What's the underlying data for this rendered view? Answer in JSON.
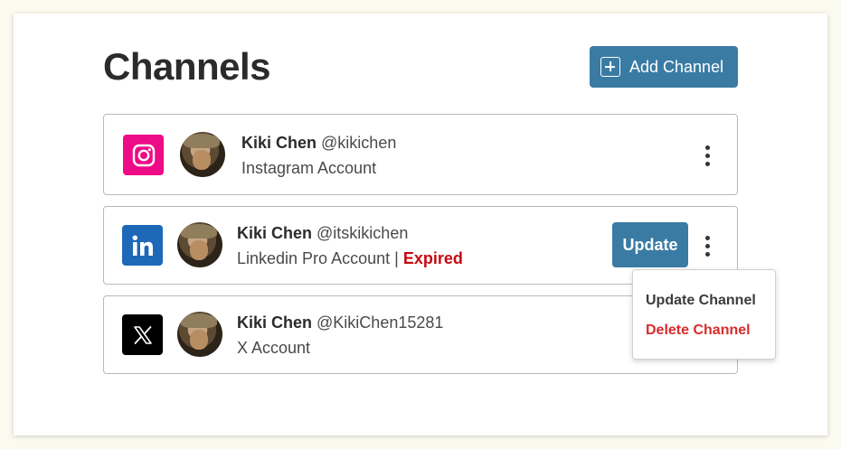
{
  "page": {
    "title": "Channels",
    "add_button_label": "Add Channel"
  },
  "channels": [
    {
      "platform": "instagram",
      "platform_icon": "instagram-icon",
      "platform_color": "#ee0b87",
      "name": "Kiki Chen",
      "handle": "@kikichen",
      "account_type": "Instagram Account"
    },
    {
      "platform": "linkedin",
      "platform_icon": "linkedin-icon",
      "platform_color": "#1e68b8",
      "name": "Kiki Chen",
      "handle": "@itskikichen",
      "account_type": "Linkedin Pro Account",
      "separator": " | ",
      "status": "Expired",
      "status_color": "#c40b10",
      "update_label": "Update"
    },
    {
      "platform": "x",
      "platform_icon": "x-icon",
      "platform_color": "#000000",
      "name": "Kiki Chen",
      "handle": "@KikiChen15281",
      "account_type": "X Account"
    }
  ],
  "context_menu": {
    "items": [
      {
        "label": "Update Channel",
        "color": "#3b3b3b"
      },
      {
        "label": "Delete Channel",
        "color": "#d92b2b"
      }
    ]
  },
  "colors": {
    "accent": "#3a7ba4",
    "page_background": "#fbfaef"
  }
}
